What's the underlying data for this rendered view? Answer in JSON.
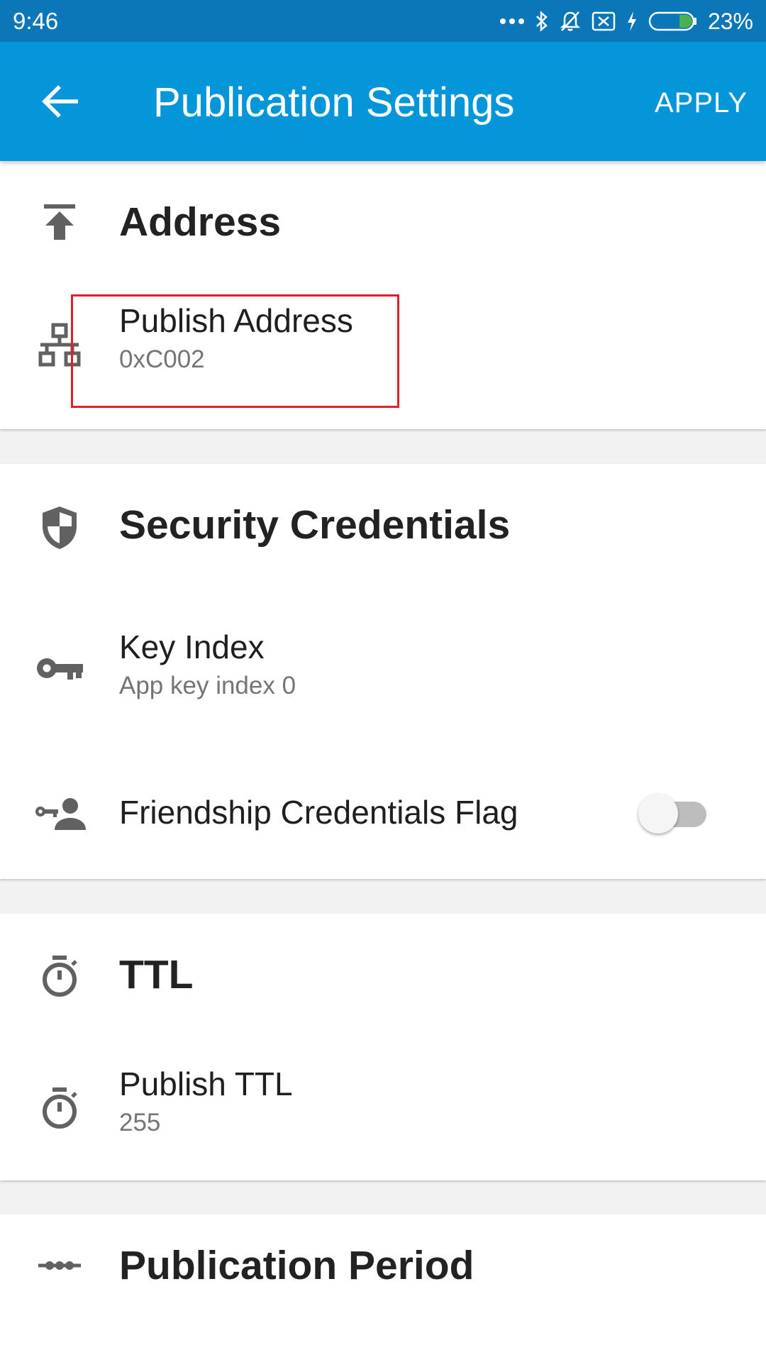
{
  "status_bar": {
    "time": "9:46",
    "battery": "23%"
  },
  "app_bar": {
    "title": "Publication Settings",
    "action": "APPLY"
  },
  "sections": {
    "address": {
      "title": "Address",
      "icon": "publish-icon",
      "items": [
        {
          "label": "Publish Address",
          "value": "0xC002",
          "icon": "network-icon"
        }
      ]
    },
    "security": {
      "title": "Security Credentials",
      "icon": "shield-icon",
      "items": [
        {
          "label": "Key Index",
          "value": "App key index 0",
          "icon": "key-icon"
        },
        {
          "label": "Friendship Credentials Flag",
          "icon": "key-person-icon",
          "toggle_on": false
        }
      ]
    },
    "ttl": {
      "title": "TTL",
      "icon": "timer-icon",
      "items": [
        {
          "label": "Publish TTL",
          "value": "255",
          "icon": "timer-icon"
        }
      ]
    },
    "period": {
      "title": "Publication Period",
      "icon": "period-icon"
    }
  },
  "colors": {
    "status_bar": "#0b77b8",
    "app_bar": "#0496d8",
    "highlight": "#e0202e",
    "battery_level": "#4caf50"
  }
}
